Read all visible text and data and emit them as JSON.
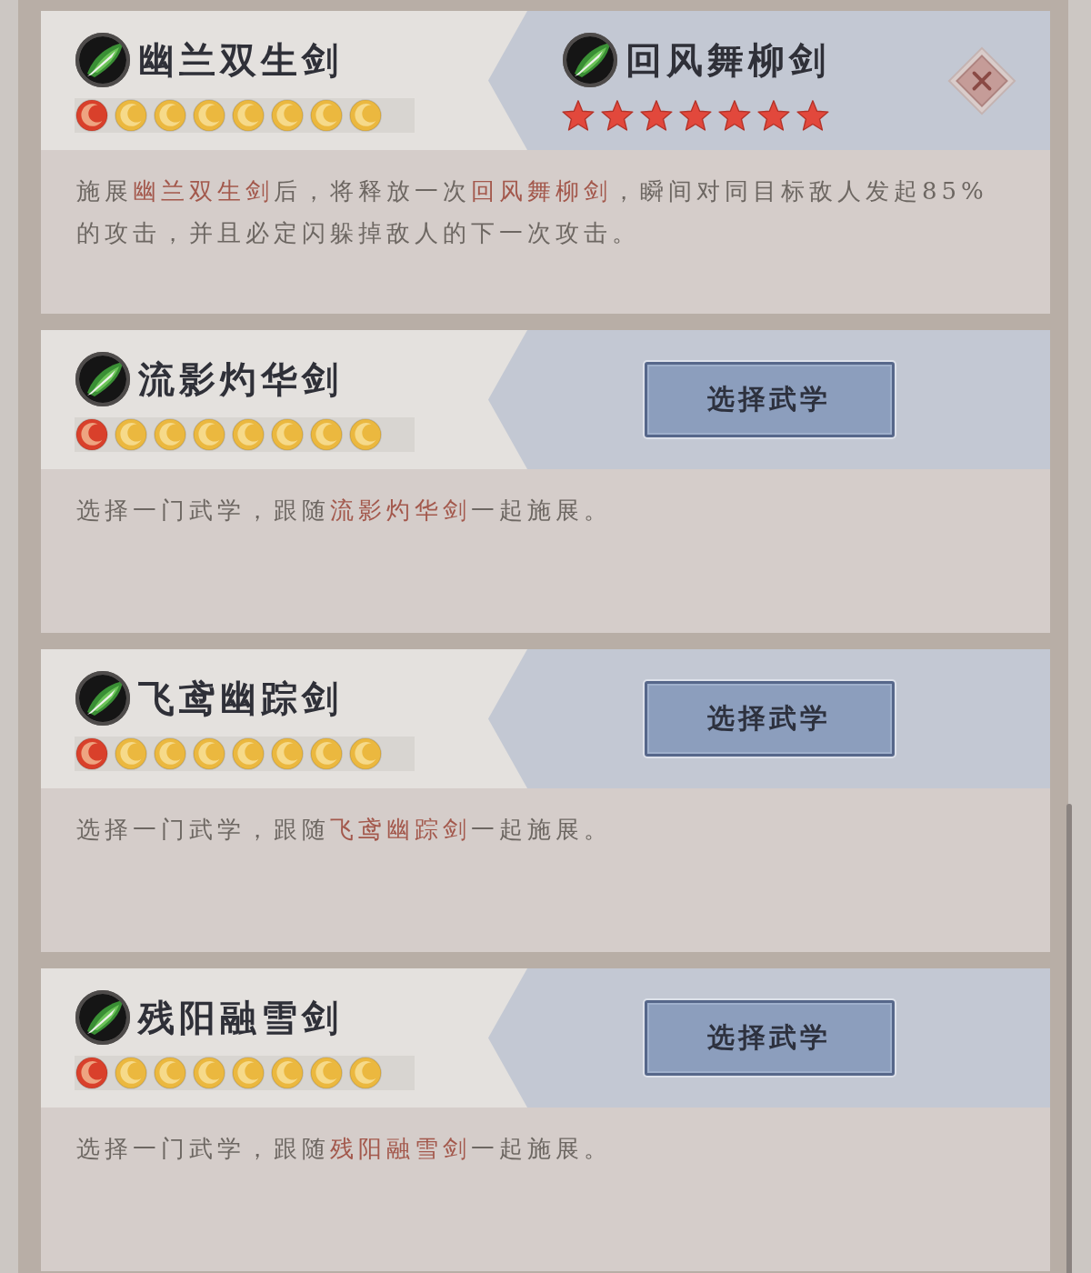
{
  "cards": [
    {
      "kind": "paired",
      "skill": {
        "name": "幽兰双生剑",
        "moons": [
          {
            "color": "#d9402b"
          },
          {
            "color": "#ebb83f"
          },
          {
            "color": "#ebb83f"
          },
          {
            "color": "#ebb83f"
          },
          {
            "color": "#ebb83f"
          },
          {
            "color": "#ebb83f"
          },
          {
            "color": "#ebb83f"
          },
          {
            "color": "#ebb83f"
          }
        ]
      },
      "paired_skill": {
        "name": "回风舞柳剑",
        "stars": 7
      },
      "description": [
        {
          "text": "施展",
          "highlight": false
        },
        {
          "text": "幽兰双生剑",
          "highlight": true
        },
        {
          "text": "后，将释放一次",
          "highlight": false
        },
        {
          "text": "回风舞柳剑",
          "highlight": true
        },
        {
          "text": "，瞬间对同目标敌人发起85%的攻击，并且必定闪躲掉敌人的下一次攻击。",
          "highlight": false
        }
      ]
    },
    {
      "kind": "select",
      "skill": {
        "name": "流影灼华剑",
        "moons": [
          {
            "color": "#d9402b"
          },
          {
            "color": "#ebb83f"
          },
          {
            "color": "#ebb83f"
          },
          {
            "color": "#ebb83f"
          },
          {
            "color": "#ebb83f"
          },
          {
            "color": "#ebb83f"
          },
          {
            "color": "#ebb83f"
          },
          {
            "color": "#ebb83f"
          }
        ]
      },
      "button": {
        "label": "选择武学"
      },
      "description": [
        {
          "text": "选择一门武学，跟随",
          "highlight": false
        },
        {
          "text": "流影灼华剑",
          "highlight": true
        },
        {
          "text": "一起施展。",
          "highlight": false
        }
      ]
    },
    {
      "kind": "select",
      "skill": {
        "name": "飞鸢幽踪剑",
        "moons": [
          {
            "color": "#d9402b"
          },
          {
            "color": "#ebb83f"
          },
          {
            "color": "#ebb83f"
          },
          {
            "color": "#ebb83f"
          },
          {
            "color": "#ebb83f"
          },
          {
            "color": "#ebb83f"
          },
          {
            "color": "#ebb83f"
          },
          {
            "color": "#ebb83f"
          }
        ]
      },
      "button": {
        "label": "选择武学"
      },
      "description": [
        {
          "text": "选择一门武学，跟随",
          "highlight": false
        },
        {
          "text": "飞鸢幽踪剑",
          "highlight": true
        },
        {
          "text": "一起施展。",
          "highlight": false
        }
      ]
    },
    {
      "kind": "select",
      "skill": {
        "name": "残阳融雪剑",
        "moons": [
          {
            "color": "#d9402b"
          },
          {
            "color": "#ebb83f"
          },
          {
            "color": "#ebb83f"
          },
          {
            "color": "#ebb83f"
          },
          {
            "color": "#ebb83f"
          },
          {
            "color": "#ebb83f"
          },
          {
            "color": "#ebb83f"
          },
          {
            "color": "#ebb83f"
          }
        ]
      },
      "button": {
        "label": "选择武学"
      },
      "description": [
        {
          "text": "选择一门武学，跟随",
          "highlight": false
        },
        {
          "text": "残阳融雪剑",
          "highlight": true
        },
        {
          "text": "一起施展。",
          "highlight": false
        }
      ]
    }
  ]
}
